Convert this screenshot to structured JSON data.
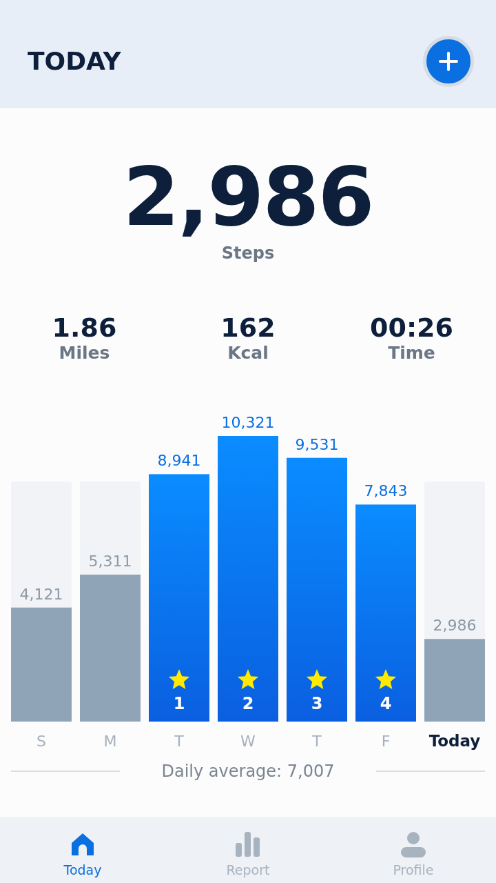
{
  "header": {
    "title": "TODAY"
  },
  "summary": {
    "value": "2,986",
    "unit": "Steps"
  },
  "stats": [
    {
      "value": "1.86",
      "label": "Miles"
    },
    {
      "value": "162",
      "label": "Kcal"
    },
    {
      "value": "00:26",
      "label": "Time"
    }
  ],
  "chart": {
    "chart_data": {
      "type": "bar",
      "categories": [
        "S",
        "M",
        "T",
        "W",
        "T",
        "F",
        "Today"
      ],
      "values": [
        4121,
        5311,
        8941,
        10321,
        9531,
        7843,
        2986
      ],
      "value_labels": [
        "4,121",
        "5,311",
        "8,941",
        "10,321",
        "9,531",
        "7,843",
        "2,986"
      ]
    },
    "days": [
      {
        "goal_met": false,
        "selected": false
      },
      {
        "goal_met": false,
        "selected": false
      },
      {
        "goal_met": true,
        "badge": "1",
        "selected": false
      },
      {
        "goal_met": true,
        "badge": "2",
        "selected": false
      },
      {
        "goal_met": true,
        "badge": "3",
        "selected": false
      },
      {
        "goal_met": true,
        "badge": "4",
        "selected": false
      },
      {
        "goal_met": false,
        "selected": true
      }
    ],
    "average": "Daily average: 7,007"
  },
  "nav": [
    {
      "label": "Today",
      "selected": true
    },
    {
      "label": "Report",
      "selected": false
    },
    {
      "label": "Profile",
      "selected": false
    }
  ]
}
